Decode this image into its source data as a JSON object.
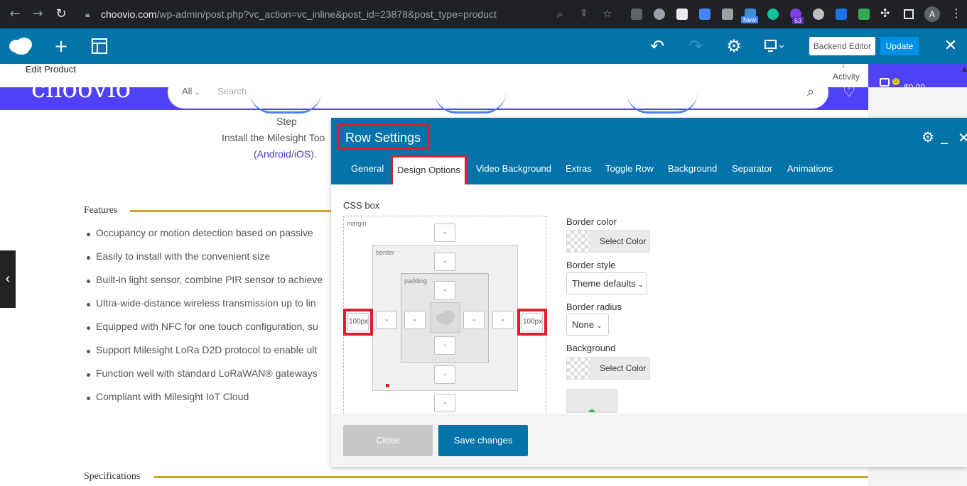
{
  "browser": {
    "url_host": "choovio.com",
    "url_path": "/wp-admin/post.php?vc_action=vc_inline&post_id=23878&post_type=product",
    "ext_new_badge": "New",
    "ext_count_badge": "63",
    "avatar_letter": "A"
  },
  "vc_toolbar": {
    "backend_editor_label": "Backend Editor",
    "update_label": "Update"
  },
  "admin": {
    "edit_product": "Edit Product",
    "activity": "Activity"
  },
  "site": {
    "logo": "choovio",
    "search_category": "All",
    "search_placeholder": "Search",
    "cart_count": "0",
    "cart_total": "$0.00"
  },
  "page": {
    "step_title": "Step",
    "step_text": "Install the Milesight Too",
    "step_links_open": "(",
    "step_link_android": "Android",
    "step_link_sep": "/",
    "step_link_ios": "iOS",
    "step_links_close": ").",
    "features_title": "Features",
    "features": [
      "Occupancy or motion detection based on passive",
      "Easily to install with the convenient size",
      "Built-in light sensor, combine PIR sensor to achieve",
      "Ultra-wide-distance wireless transmission up to lin",
      "Equipped with NFC for one touch configuration, su",
      "Support Milesight LoRa D2D protocol to enable ult",
      "Function well with standard LoRaWAN® gateways",
      "Compliant with Milesight IoT Cloud"
    ],
    "specifications_title": "Specifications"
  },
  "modal": {
    "title": "Row Settings",
    "tabs": [
      "General",
      "Design Options",
      "Video Background",
      "Extras",
      "Toggle Row",
      "Background",
      "Separator",
      "Animations"
    ],
    "css_box_label": "CSS box",
    "margin_label": "margin",
    "border_label": "border",
    "padding_label": "padding",
    "dash": "-",
    "margin_left_value": "100px",
    "margin_right_value": "100px",
    "border_color_label": "Border color",
    "select_color_label": "Select Color",
    "border_style_label": "Border style",
    "border_style_value": "Theme defaults",
    "border_radius_label": "Border radius",
    "border_radius_value": "None",
    "background_label": "Background",
    "close_label": "Close",
    "save_label": "Save changes"
  }
}
